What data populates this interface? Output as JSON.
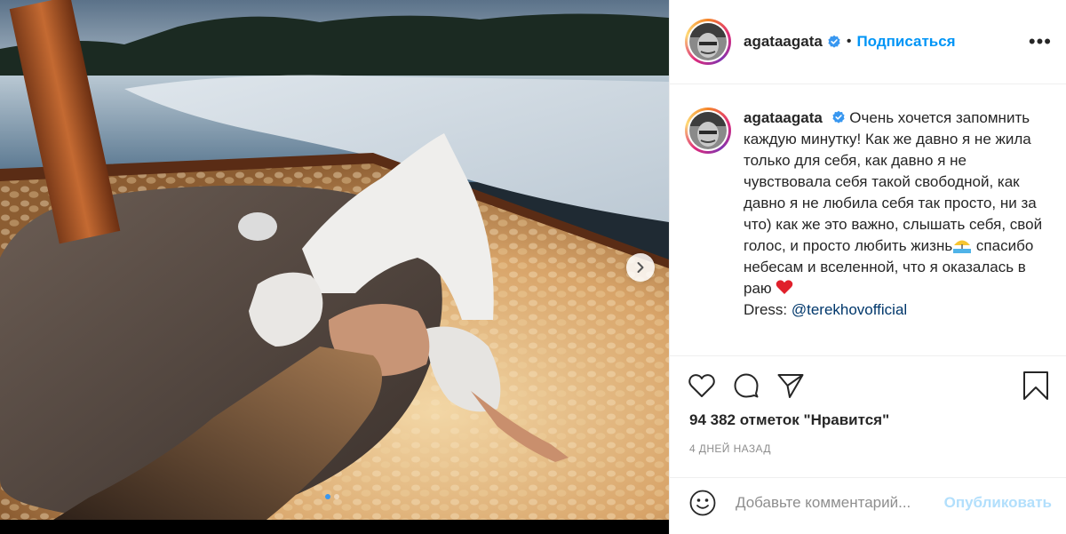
{
  "post": {
    "username": "agataagata",
    "separator": "•",
    "follow_label": "Подписаться",
    "more_label": "•••",
    "caption": {
      "username": "agataagata",
      "text_before_emoji": "Очень хочется запомнить каждую минутку! Как же давно я не жила только для себя, как давно я не чувствовала себя такой свободной, как давно я не любила себя так просто, ни за что) как же это важно, слышать себя, свой голос, и просто любить жизнь",
      "text_after_emoji": " спасибо небесам и вселенной, что я оказалась в раю ",
      "dress_label": "Dress: ",
      "mention": "@terekhovofficial"
    },
    "likes_text": "94 382 отметок \"Нравится\"",
    "time_text": "4 ДНЕЙ НАЗАД",
    "comment_placeholder": "Добавьте комментарий...",
    "publish_label": "Опубликовать",
    "carousel": {
      "current_slide": 1,
      "total_slides": 2
    }
  },
  "colors": {
    "accent": "#0095f6",
    "publish_disabled": "#b2dffc",
    "carousel_active_dot": "#3897f0",
    "text": "#262626",
    "muted": "#8e8e8e"
  },
  "icons": {
    "verified": "verified-badge-icon",
    "like": "heart-icon",
    "comment": "comment-bubble-icon",
    "share": "paper-plane-icon",
    "save": "bookmark-icon",
    "emoji": "smiley-icon",
    "next": "chevron-right-icon",
    "caption_emoji_1": "beach-umbrella-emoji",
    "caption_emoji_2": "red-heart-emoji"
  }
}
